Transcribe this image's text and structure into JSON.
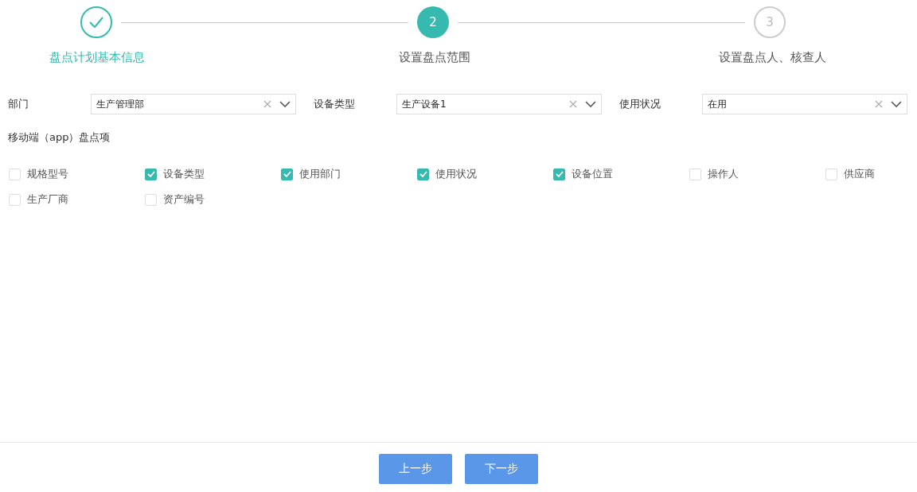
{
  "steps": [
    {
      "label": "盘点计划基本信息",
      "done": true,
      "selected": false
    },
    {
      "number": "2",
      "label": "设置盘点范围",
      "done": false,
      "selected": true
    },
    {
      "number": "3",
      "label": "设置盘点人、核查人",
      "done": false,
      "selected": false
    }
  ],
  "filters": [
    {
      "label": "部门",
      "value": "生产管理部"
    },
    {
      "label": "设备类型",
      "value": "生产设备1"
    },
    {
      "label": "使用状况",
      "value": "在用"
    }
  ],
  "app_items_title": "移动端（app）盘点项",
  "app_items": [
    {
      "label": "规格型号",
      "checked": false
    },
    {
      "label": "设备类型",
      "checked": true
    },
    {
      "label": "使用部门",
      "checked": true
    },
    {
      "label": "使用状况",
      "checked": true
    },
    {
      "label": "设备位置",
      "checked": true
    },
    {
      "label": "操作人",
      "checked": false
    },
    {
      "label": "供应商",
      "checked": false
    },
    {
      "label": "生产厂商",
      "checked": false
    },
    {
      "label": "资产编号",
      "checked": false
    }
  ],
  "buttons": [
    {
      "label": "上一步"
    },
    {
      "label": "下一步"
    }
  ]
}
